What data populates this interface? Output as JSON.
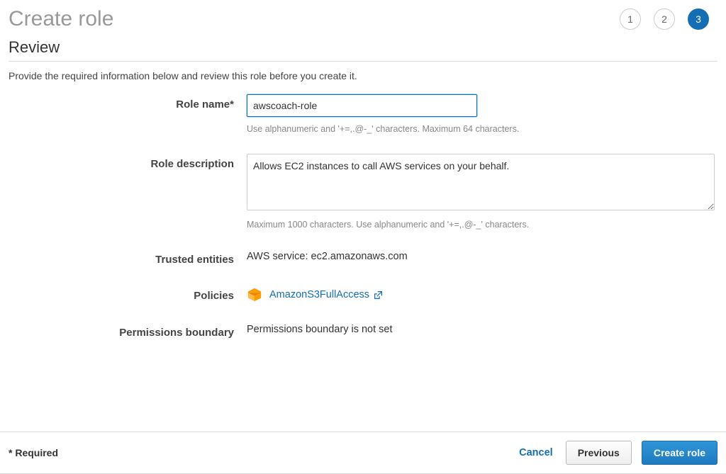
{
  "page": {
    "title": "Create role",
    "subtitle": "Review",
    "intro": "Provide the required information below and review this role before you create it."
  },
  "steps": {
    "s1": "1",
    "s2": "2",
    "s3": "3"
  },
  "form": {
    "roleName": {
      "label": "Role name*",
      "value": "awscoach-role",
      "hint": "Use alphanumeric and '+=,.@-_' characters. Maximum 64 characters."
    },
    "roleDescription": {
      "label": "Role description",
      "value": "Allows EC2 instances to call AWS services on your behalf.",
      "hint": "Maximum 1000 characters. Use alphanumeric and '+=,.@-_' characters."
    },
    "trustedEntities": {
      "label": "Trusted entities",
      "value": "AWS service: ec2.amazonaws.com"
    },
    "policies": {
      "label": "Policies",
      "name": "AmazonS3FullAccess"
    },
    "permissionsBoundary": {
      "label": "Permissions boundary",
      "value": "Permissions boundary is not set"
    }
  },
  "footer": {
    "required": "* Required",
    "cancel": "Cancel",
    "previous": "Previous",
    "create": "Create role"
  }
}
